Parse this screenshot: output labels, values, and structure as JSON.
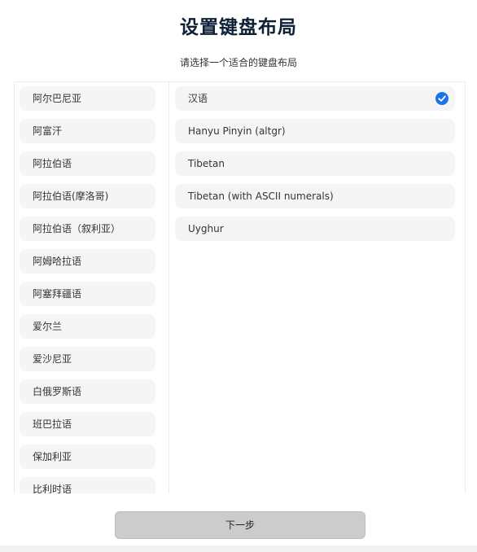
{
  "header": {
    "title": "设置键盘布局",
    "subtitle": "请选择一个适合的键盘布局"
  },
  "languages": [
    "阿尔巴尼亚",
    "阿富汗",
    "阿拉伯语",
    "阿拉伯语(摩洛哥)",
    "阿拉伯语（叙利亚）",
    "阿姆哈拉语",
    "阿塞拜疆语",
    "爱尔兰",
    "爱沙尼亚",
    "白俄罗斯语",
    "班巴拉语",
    "保加利亚",
    "比利时语"
  ],
  "layouts": [
    "汉语",
    "Hanyu Pinyin (altgr)",
    "Tibetan",
    "Tibetan (with ASCII numerals)",
    "Uyghur"
  ],
  "selected_layout": "汉语",
  "accent_color": "#1a73e8",
  "icons": {
    "selected_check": "check-circle-icon"
  },
  "footer": {
    "next_label": "下一步"
  }
}
